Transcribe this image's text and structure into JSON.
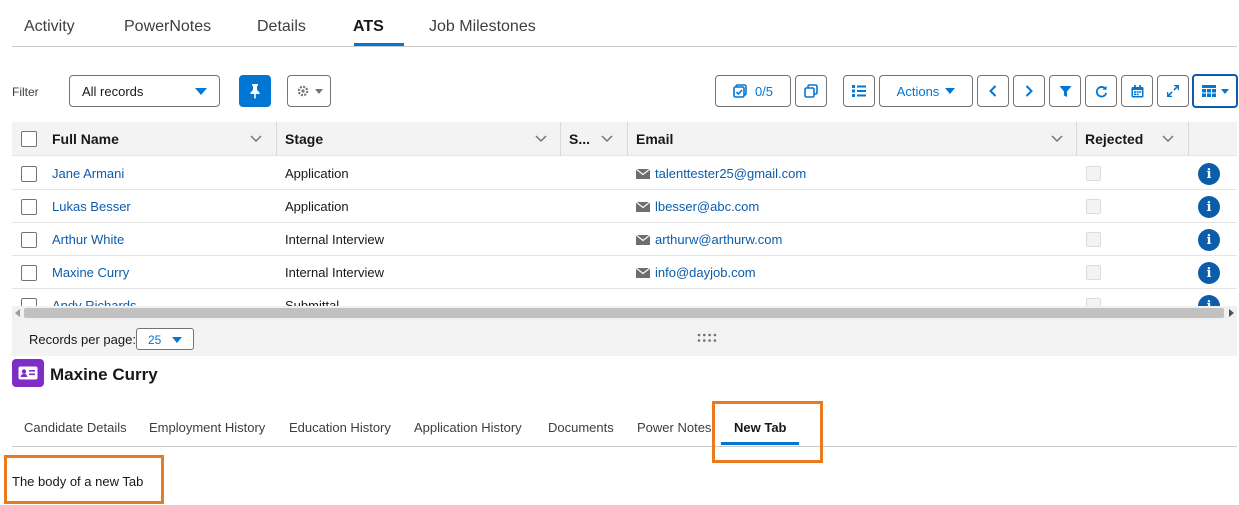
{
  "top_tabs": [
    {
      "label": "Activity"
    },
    {
      "label": "PowerNotes"
    },
    {
      "label": "Details"
    },
    {
      "label": "ATS",
      "active": true
    },
    {
      "label": "Job Milestones"
    }
  ],
  "toolbar": {
    "filter_label": "Filter",
    "filter_value": "All records",
    "selected_count": "0/5",
    "actions_label": "Actions"
  },
  "table": {
    "columns": [
      "Full Name",
      "Stage",
      "S...",
      "Email",
      "Rejected"
    ],
    "rows": [
      {
        "name": "Jane Armani",
        "stage": "Application",
        "email": "talenttester25@gmail.com"
      },
      {
        "name": "Lukas Besser",
        "stage": "Application",
        "email": "lbesser@abc.com"
      },
      {
        "name": "Arthur White",
        "stage": "Internal Interview",
        "email": "arthurw@arthurw.com"
      },
      {
        "name": "Maxine Curry",
        "stage": "Internal Interview",
        "email": "info@dayjob.com"
      },
      {
        "name": "Andy Richards",
        "stage": "Submittal",
        "email": ""
      }
    ],
    "info_glyph": "i"
  },
  "pagination": {
    "records_per_page_label": "Records per page:",
    "records_per_page_value": "25"
  },
  "record": {
    "title": "Maxine Curry",
    "icon": "contact-card-icon"
  },
  "sub_tabs": [
    {
      "label": "Candidate Details"
    },
    {
      "label": "Employment History"
    },
    {
      "label": "Education History"
    },
    {
      "label": "Application History"
    },
    {
      "label": "Documents"
    },
    {
      "label": "Power Notes"
    },
    {
      "label": "New Tab",
      "active": true
    }
  ],
  "tab_body": "The body of a new Tab",
  "colors": {
    "brand": "#0176d3",
    "link": "#0b5cab",
    "highlight": "#ea7a1e",
    "record_icon": "#7f2ec5"
  }
}
